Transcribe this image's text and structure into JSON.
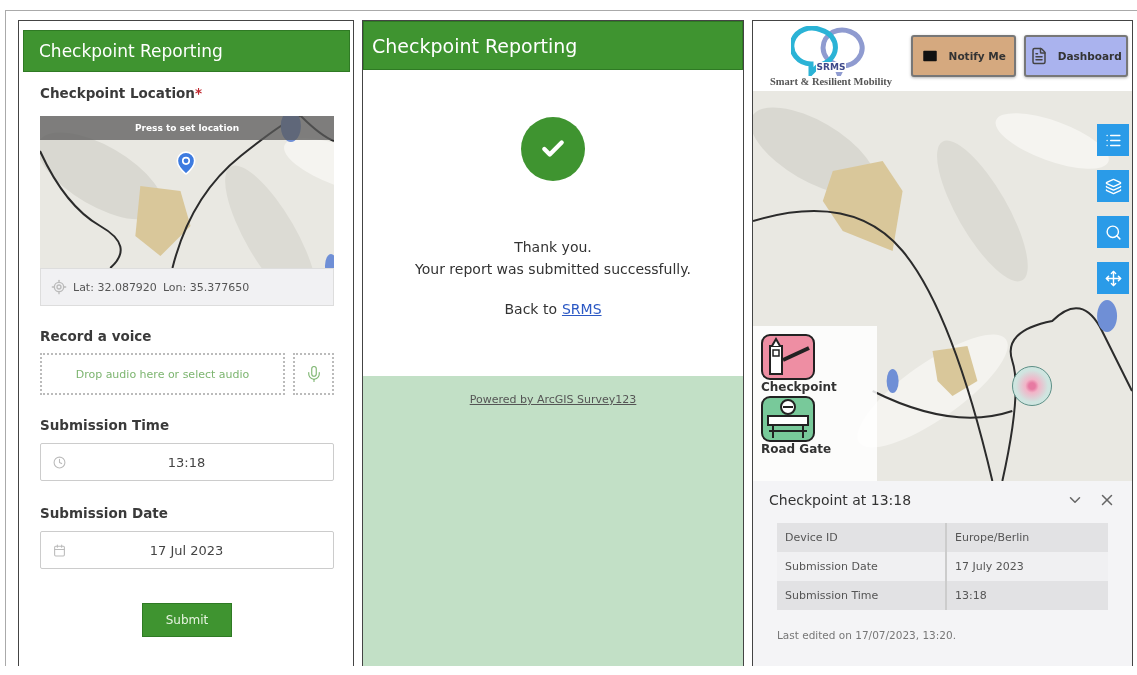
{
  "form_screen": {
    "header_title": "Checkpoint Reporting",
    "location_question": {
      "label": "Checkpoint Location",
      "required_mark": "*",
      "banner": "Press to set location",
      "latitude": "Lat: 32.087920",
      "longitude": "Lon: 35.377650"
    },
    "fields": [
      {
        "kind": "audio",
        "label": "Record a voice",
        "placeholder": "Drop audio here or select audio"
      },
      {
        "kind": "time",
        "label": "Submission Time",
        "value": "13:18"
      },
      {
        "kind": "date",
        "label": "Submission Date",
        "value": "17 Jul 2023"
      }
    ],
    "submit_button": "Submit"
  },
  "confirmation_screen": {
    "header_title": "Checkpoint Reporting",
    "message_lines": [
      "Thank you.",
      "Your report was submitted successfully."
    ],
    "back_text": "Back to",
    "back_link": "SRMS",
    "footer_link": "Powered by ArcGIS Survey123"
  },
  "map_screen": {
    "logo": {
      "acronym": "SRMS",
      "tagline": "Smart & Resilient Mobility"
    },
    "header_buttons": [
      {
        "kind": "mail",
        "label": "Notify Me",
        "color": "#d5a97f"
      },
      {
        "kind": "dashboard",
        "label": "Dashboard",
        "color": "#aab3ee"
      }
    ],
    "map_tools": [
      {
        "kind": "legend"
      },
      {
        "kind": "layers"
      },
      {
        "kind": "search"
      },
      {
        "kind": "move"
      }
    ],
    "legend": [
      {
        "kind": "checkpoint",
        "label": "Checkpoint"
      },
      {
        "kind": "road_gate",
        "label": "Road Gate"
      }
    ],
    "popup": {
      "title": "Checkpoint at 13:18",
      "rows": [
        {
          "field": "Device ID",
          "value": "Europe/Berlin"
        },
        {
          "field": "Submission Date",
          "value": "17 July 2023"
        },
        {
          "field": "Submission Time",
          "value": "13:18"
        }
      ],
      "footer": "Last edited on 17/07/2023, 13:20."
    }
  }
}
